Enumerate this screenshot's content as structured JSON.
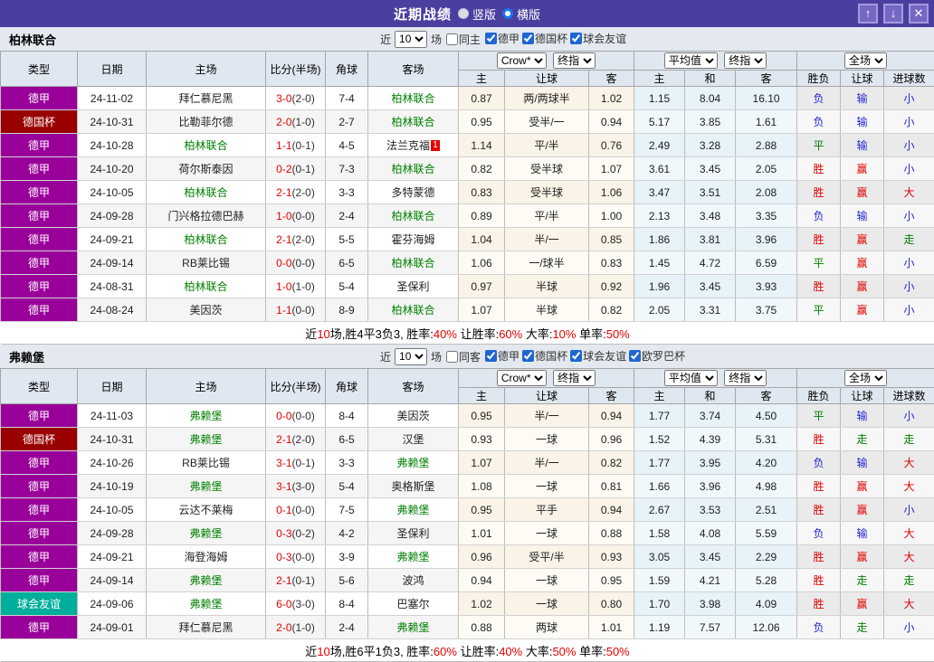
{
  "titlebar": {
    "title": "近期战绩",
    "vertical_label": "竖版",
    "horizontal_label": "横版",
    "vertical_selected": false,
    "horizontal_selected": true,
    "icons": {
      "up": "↑",
      "down": "↓",
      "close": "✕"
    }
  },
  "table_header": {
    "cols": [
      "类型",
      "日期",
      "主场",
      "比分(半场)",
      "角球",
      "客场"
    ],
    "group1_select1": "Crow*",
    "group1_select2": "终指",
    "group1_cols": [
      "主",
      "让球",
      "客"
    ],
    "group2_select1": "平均值",
    "group2_select2": "终指",
    "group2_cols": [
      "主",
      "和",
      "客"
    ],
    "group3_select": "全场",
    "group3_cols": [
      "胜负",
      "让球",
      "进球数"
    ]
  },
  "colors": {
    "titlebar_bg": "#4a3f9f",
    "team_green": "#008000",
    "score_red": "#e60000",
    "league_badges": {
      "德甲": "#990099",
      "德国杯": "#990000",
      "球会友谊": "#00af9b"
    },
    "result_map": {
      "胜": "red",
      "平": "green",
      "负": "blue",
      "赢": "red",
      "输": "blue",
      "走": "green",
      "大": "red",
      "小": "blue"
    }
  },
  "sections": [
    {
      "team": "柏林联合",
      "filter": {
        "prefix": "近",
        "count": "10",
        "suffix": "场",
        "same_venue_label": "同主",
        "leagues": [
          "德甲",
          "德国杯",
          "球会友谊"
        ]
      },
      "rows": [
        {
          "league": "德甲",
          "date": "24-11-02",
          "home": "拜仁慕尼黑",
          "home_highlight": false,
          "score": "3-0",
          "half": "(2-0)",
          "corners": "7-4",
          "away": "柏林联合",
          "away_highlight": true,
          "crow_home": "0.87",
          "handicap": "两/两球半",
          "crow_away": "1.02",
          "avg_home": "1.15",
          "avg_draw": "8.04",
          "avg_away": "16.10",
          "result_wdl": "负",
          "result_handicap": "输",
          "result_goals": "小"
        },
        {
          "league": "德国杯",
          "date": "24-10-31",
          "home": "比勒菲尔德",
          "home_highlight": false,
          "score": "2-0",
          "half": "(1-0)",
          "corners": "2-7",
          "away": "柏林联合",
          "away_highlight": true,
          "crow_home": "0.95",
          "handicap": "受半/一",
          "crow_away": "0.94",
          "avg_home": "5.17",
          "avg_draw": "3.85",
          "avg_away": "1.61",
          "result_wdl": "负",
          "result_handicap": "输",
          "result_goals": "小"
        },
        {
          "league": "德甲",
          "date": "24-10-28",
          "home": "柏林联合",
          "home_highlight": true,
          "score": "1-1",
          "half": "(0-1)",
          "corners": "4-5",
          "away": "法兰克福",
          "away_highlight": false,
          "away_red_card": "1",
          "crow_home": "1.14",
          "handicap": "平/半",
          "crow_away": "0.76",
          "avg_home": "2.49",
          "avg_draw": "3.28",
          "avg_away": "2.88",
          "result_wdl": "平",
          "result_handicap": "输",
          "result_goals": "小"
        },
        {
          "league": "德甲",
          "date": "24-10-20",
          "home": "荷尔斯泰因",
          "home_highlight": false,
          "score": "0-2",
          "half": "(0-1)",
          "corners": "7-3",
          "away": "柏林联合",
          "away_highlight": true,
          "crow_home": "0.82",
          "handicap": "受半球",
          "crow_away": "1.07",
          "avg_home": "3.61",
          "avg_draw": "3.45",
          "avg_away": "2.05",
          "result_wdl": "胜",
          "result_handicap": "赢",
          "result_goals": "小"
        },
        {
          "league": "德甲",
          "date": "24-10-05",
          "home": "柏林联合",
          "home_highlight": true,
          "score": "2-1",
          "half": "(2-0)",
          "corners": "3-3",
          "away": "多特蒙德",
          "away_highlight": false,
          "crow_home": "0.83",
          "handicap": "受半球",
          "crow_away": "1.06",
          "avg_home": "3.47",
          "avg_draw": "3.51",
          "avg_away": "2.08",
          "result_wdl": "胜",
          "result_handicap": "赢",
          "result_goals": "大"
        },
        {
          "league": "德甲",
          "date": "24-09-28",
          "home": "门兴格拉德巴赫",
          "home_highlight": false,
          "score": "1-0",
          "half": "(0-0)",
          "corners": "2-4",
          "away": "柏林联合",
          "away_highlight": true,
          "crow_home": "0.89",
          "handicap": "平/半",
          "crow_away": "1.00",
          "avg_home": "2.13",
          "avg_draw": "3.48",
          "avg_away": "3.35",
          "result_wdl": "负",
          "result_handicap": "输",
          "result_goals": "小"
        },
        {
          "league": "德甲",
          "date": "24-09-21",
          "home": "柏林联合",
          "home_highlight": true,
          "score": "2-1",
          "half": "(2-0)",
          "corners": "5-5",
          "away": "霍芬海姆",
          "away_highlight": false,
          "crow_home": "1.04",
          "handicap": "半/一",
          "crow_away": "0.85",
          "avg_home": "1.86",
          "avg_draw": "3.81",
          "avg_away": "3.96",
          "result_wdl": "胜",
          "result_handicap": "赢",
          "result_goals": "走"
        },
        {
          "league": "德甲",
          "date": "24-09-14",
          "home": "RB莱比锡",
          "home_highlight": false,
          "score": "0-0",
          "half": "(0-0)",
          "corners": "6-5",
          "away": "柏林联合",
          "away_highlight": true,
          "crow_home": "1.06",
          "handicap": "一/球半",
          "crow_away": "0.83",
          "avg_home": "1.45",
          "avg_draw": "4.72",
          "avg_away": "6.59",
          "result_wdl": "平",
          "result_handicap": "赢",
          "result_goals": "小"
        },
        {
          "league": "德甲",
          "date": "24-08-31",
          "home": "柏林联合",
          "home_highlight": true,
          "score": "1-0",
          "half": "(1-0)",
          "corners": "5-4",
          "away": "圣保利",
          "away_highlight": false,
          "crow_home": "0.97",
          "handicap": "半球",
          "crow_away": "0.92",
          "avg_home": "1.96",
          "avg_draw": "3.45",
          "avg_away": "3.93",
          "result_wdl": "胜",
          "result_handicap": "赢",
          "result_goals": "小"
        },
        {
          "league": "德甲",
          "date": "24-08-24",
          "home": "美因茨",
          "home_highlight": false,
          "score": "1-1",
          "half": "(0-0)",
          "corners": "8-9",
          "away": "柏林联合",
          "away_highlight": true,
          "crow_home": "1.07",
          "handicap": "半球",
          "crow_away": "0.82",
          "avg_home": "2.05",
          "avg_draw": "3.31",
          "avg_away": "3.75",
          "result_wdl": "平",
          "result_handicap": "赢",
          "result_goals": "小"
        }
      ],
      "summary": [
        {
          "text": "近",
          "red": false
        },
        {
          "text": "10",
          "red": true
        },
        {
          "text": "场,胜4平3负3, 胜率:",
          "red": false
        },
        {
          "text": "40%",
          "red": true
        },
        {
          "text": " 让胜率:",
          "red": false
        },
        {
          "text": "60%",
          "red": true
        },
        {
          "text": " 大率:",
          "red": false
        },
        {
          "text": "10%",
          "red": true
        },
        {
          "text": " 单率:",
          "red": false
        },
        {
          "text": "50%",
          "red": true
        }
      ]
    },
    {
      "team": "弗赖堡",
      "filter": {
        "prefix": "近",
        "count": "10",
        "suffix": "场",
        "same_venue_label": "同客",
        "leagues": [
          "德甲",
          "德国杯",
          "球会友谊",
          "欧罗巴杯"
        ]
      },
      "rows": [
        {
          "league": "德甲",
          "date": "24-11-03",
          "home": "弗赖堡",
          "home_highlight": true,
          "score": "0-0",
          "half": "(0-0)",
          "corners": "8-4",
          "away": "美因茨",
          "away_highlight": false,
          "crow_home": "0.95",
          "handicap": "半/一",
          "crow_away": "0.94",
          "avg_home": "1.77",
          "avg_draw": "3.74",
          "avg_away": "4.50",
          "result_wdl": "平",
          "result_handicap": "输",
          "result_goals": "小"
        },
        {
          "league": "德国杯",
          "date": "24-10-31",
          "home": "弗赖堡",
          "home_highlight": true,
          "score": "2-1",
          "half": "(2-0)",
          "corners": "6-5",
          "away": "汉堡",
          "away_highlight": false,
          "crow_home": "0.93",
          "handicap": "一球",
          "crow_away": "0.96",
          "avg_home": "1.52",
          "avg_draw": "4.39",
          "avg_away": "5.31",
          "result_wdl": "胜",
          "result_handicap": "走",
          "result_goals": "走"
        },
        {
          "league": "德甲",
          "date": "24-10-26",
          "home": "RB莱比锡",
          "home_highlight": false,
          "score": "3-1",
          "half": "(0-1)",
          "corners": "3-3",
          "away": "弗赖堡",
          "away_highlight": true,
          "crow_home": "1.07",
          "handicap": "半/一",
          "crow_away": "0.82",
          "avg_home": "1.77",
          "avg_draw": "3.95",
          "avg_away": "4.20",
          "result_wdl": "负",
          "result_handicap": "输",
          "result_goals": "大"
        },
        {
          "league": "德甲",
          "date": "24-10-19",
          "home": "弗赖堡",
          "home_highlight": true,
          "score": "3-1",
          "half": "(3-0)",
          "corners": "5-4",
          "away": "奥格斯堡",
          "away_highlight": false,
          "crow_home": "1.08",
          "handicap": "一球",
          "crow_away": "0.81",
          "avg_home": "1.66",
          "avg_draw": "3.96",
          "avg_away": "4.98",
          "result_wdl": "胜",
          "result_handicap": "赢",
          "result_goals": "大"
        },
        {
          "league": "德甲",
          "date": "24-10-05",
          "home": "云达不莱梅",
          "home_highlight": false,
          "score": "0-1",
          "half": "(0-0)",
          "corners": "7-5",
          "away": "弗赖堡",
          "away_highlight": true,
          "crow_home": "0.95",
          "handicap": "平手",
          "crow_away": "0.94",
          "avg_home": "2.67",
          "avg_draw": "3.53",
          "avg_away": "2.51",
          "result_wdl": "胜",
          "result_handicap": "赢",
          "result_goals": "小"
        },
        {
          "league": "德甲",
          "date": "24-09-28",
          "home": "弗赖堡",
          "home_highlight": true,
          "score": "0-3",
          "half": "(0-2)",
          "corners": "4-2",
          "away": "圣保利",
          "away_highlight": false,
          "crow_home": "1.01",
          "handicap": "一球",
          "crow_away": "0.88",
          "avg_home": "1.58",
          "avg_draw": "4.08",
          "avg_away": "5.59",
          "result_wdl": "负",
          "result_handicap": "输",
          "result_goals": "大"
        },
        {
          "league": "德甲",
          "date": "24-09-21",
          "home": "海登海姆",
          "home_highlight": false,
          "score": "0-3",
          "half": "(0-0)",
          "corners": "3-9",
          "away": "弗赖堡",
          "away_highlight": true,
          "crow_home": "0.96",
          "handicap": "受平/半",
          "crow_away": "0.93",
          "avg_home": "3.05",
          "avg_draw": "3.45",
          "avg_away": "2.29",
          "result_wdl": "胜",
          "result_handicap": "赢",
          "result_goals": "大"
        },
        {
          "league": "德甲",
          "date": "24-09-14",
          "home": "弗赖堡",
          "home_highlight": true,
          "score": "2-1",
          "half": "(0-1)",
          "corners": "5-6",
          "away": "波鸿",
          "away_highlight": false,
          "crow_home": "0.94",
          "handicap": "一球",
          "crow_away": "0.95",
          "avg_home": "1.59",
          "avg_draw": "4.21",
          "avg_away": "5.28",
          "result_wdl": "胜",
          "result_handicap": "走",
          "result_goals": "走"
        },
        {
          "league": "球会友谊",
          "date": "24-09-06",
          "home": "弗赖堡",
          "home_highlight": true,
          "score": "6-0",
          "half": "(3-0)",
          "corners": "8-4",
          "away": "巴塞尔",
          "away_highlight": false,
          "crow_home": "1.02",
          "handicap": "一球",
          "crow_away": "0.80",
          "avg_home": "1.70",
          "avg_draw": "3.98",
          "avg_away": "4.09",
          "result_wdl": "胜",
          "result_handicap": "赢",
          "result_goals": "大"
        },
        {
          "league": "德甲",
          "date": "24-09-01",
          "home": "拜仁慕尼黑",
          "home_highlight": false,
          "score": "2-0",
          "half": "(1-0)",
          "corners": "2-4",
          "away": "弗赖堡",
          "away_highlight": true,
          "crow_home": "0.88",
          "handicap": "两球",
          "crow_away": "1.01",
          "avg_home": "1.19",
          "avg_draw": "7.57",
          "avg_away": "12.06",
          "result_wdl": "负",
          "result_handicap": "走",
          "result_goals": "小"
        }
      ],
      "summary": [
        {
          "text": "近",
          "red": false
        },
        {
          "text": "10",
          "red": true
        },
        {
          "text": "场,胜6平1负3, 胜率:",
          "red": false
        },
        {
          "text": "60%",
          "red": true
        },
        {
          "text": " 让胜率:",
          "red": false
        },
        {
          "text": "40%",
          "red": true
        },
        {
          "text": " 大率:",
          "red": false
        },
        {
          "text": "50%",
          "red": true
        },
        {
          "text": " 单率:",
          "red": false
        },
        {
          "text": "50%",
          "red": true
        }
      ]
    }
  ]
}
